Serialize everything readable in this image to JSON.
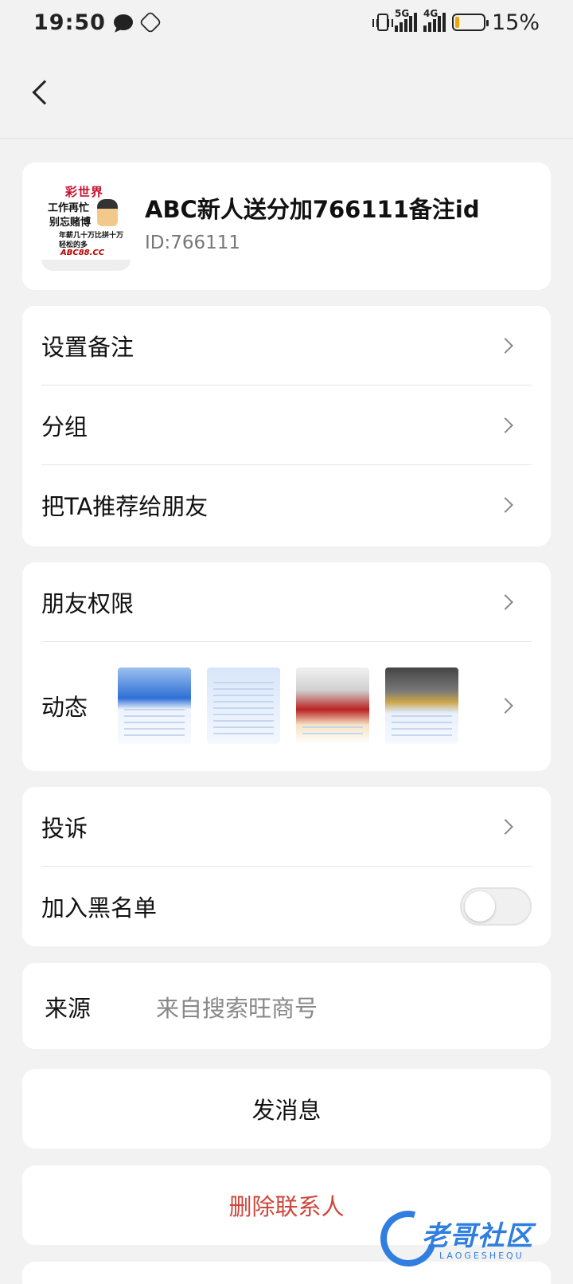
{
  "status_bar": {
    "time": "19:50",
    "signal_5g": "5G",
    "signal_4g": "4G",
    "battery_percent": "15%",
    "battery_level": 0.15,
    "battery_color": "#f0a400"
  },
  "profile": {
    "name": "ABC新人送分加766111备注id",
    "id_text": "ID:766111",
    "avatar": {
      "title": "彩世界",
      "line1": "工作再忙",
      "line2": "别忘赌博",
      "line3": "年薪几十万比拼十万",
      "line4": "轻松的多",
      "line5": "ABC88.CC"
    }
  },
  "settings": {
    "set_remark": "设置备注",
    "group": "分组",
    "recommend": "把TA推荐给朋友"
  },
  "permissions": {
    "friend_permissions": "朋友权限",
    "moments": "动态"
  },
  "report": {
    "complaint": "投诉",
    "blacklist": "加入黑名单",
    "blacklist_on": false
  },
  "source": {
    "label": "来源",
    "value": "来自搜索旺商号"
  },
  "actions": {
    "send_message": "发消息",
    "delete_contact": "删除联系人",
    "delete_color": "#d0453a"
  },
  "watermark": {
    "text": "老哥社区",
    "sub": "LAOGESHEQU"
  }
}
